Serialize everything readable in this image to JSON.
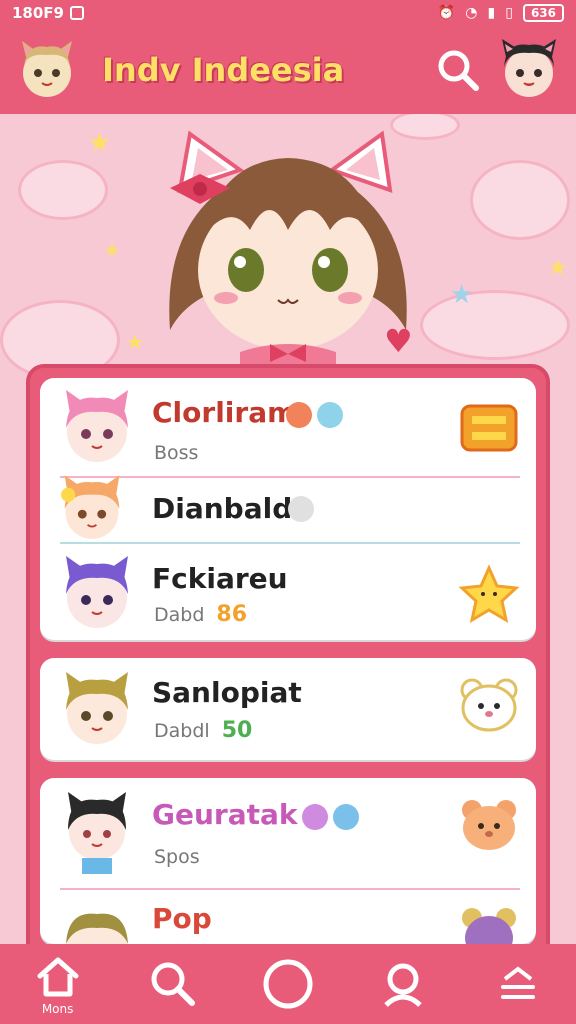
{
  "status_bar": {
    "time": "180F9",
    "battery": "636"
  },
  "header": {
    "title": "Indv Indeesia"
  },
  "list": [
    {
      "name": "Clorliram",
      "sub": "Boss",
      "num": "",
      "name_color": "#c23a2e"
    },
    {
      "name": "Dianbald",
      "sub": "",
      "num": "",
      "name_color": "#222222"
    },
    {
      "name": "Fckiareu",
      "sub": "Dabd",
      "num": "86",
      "name_color": "#222222",
      "num_color": "#f2a22b"
    },
    {
      "name": "Sanlopiat",
      "sub": "Dabdl",
      "num": "50",
      "name_color": "#222222",
      "num_color": "#4caf50"
    },
    {
      "name": "Geuratak",
      "sub": "Spos",
      "num": "",
      "name_color": "#c75ab8"
    },
    {
      "name": "Pop",
      "sub": "",
      "num": "",
      "name_color": "#d9493a"
    }
  ],
  "bottom_nav": {
    "home_label": "Mons"
  },
  "icons": {
    "search": "search-icon",
    "home": "home-icon",
    "circle": "circle-icon",
    "profile": "profile-icon",
    "menu": "menu-icon"
  },
  "colors": {
    "accent": "#e85c7a",
    "title": "#ffe066",
    "background": "#f7c9d4"
  }
}
